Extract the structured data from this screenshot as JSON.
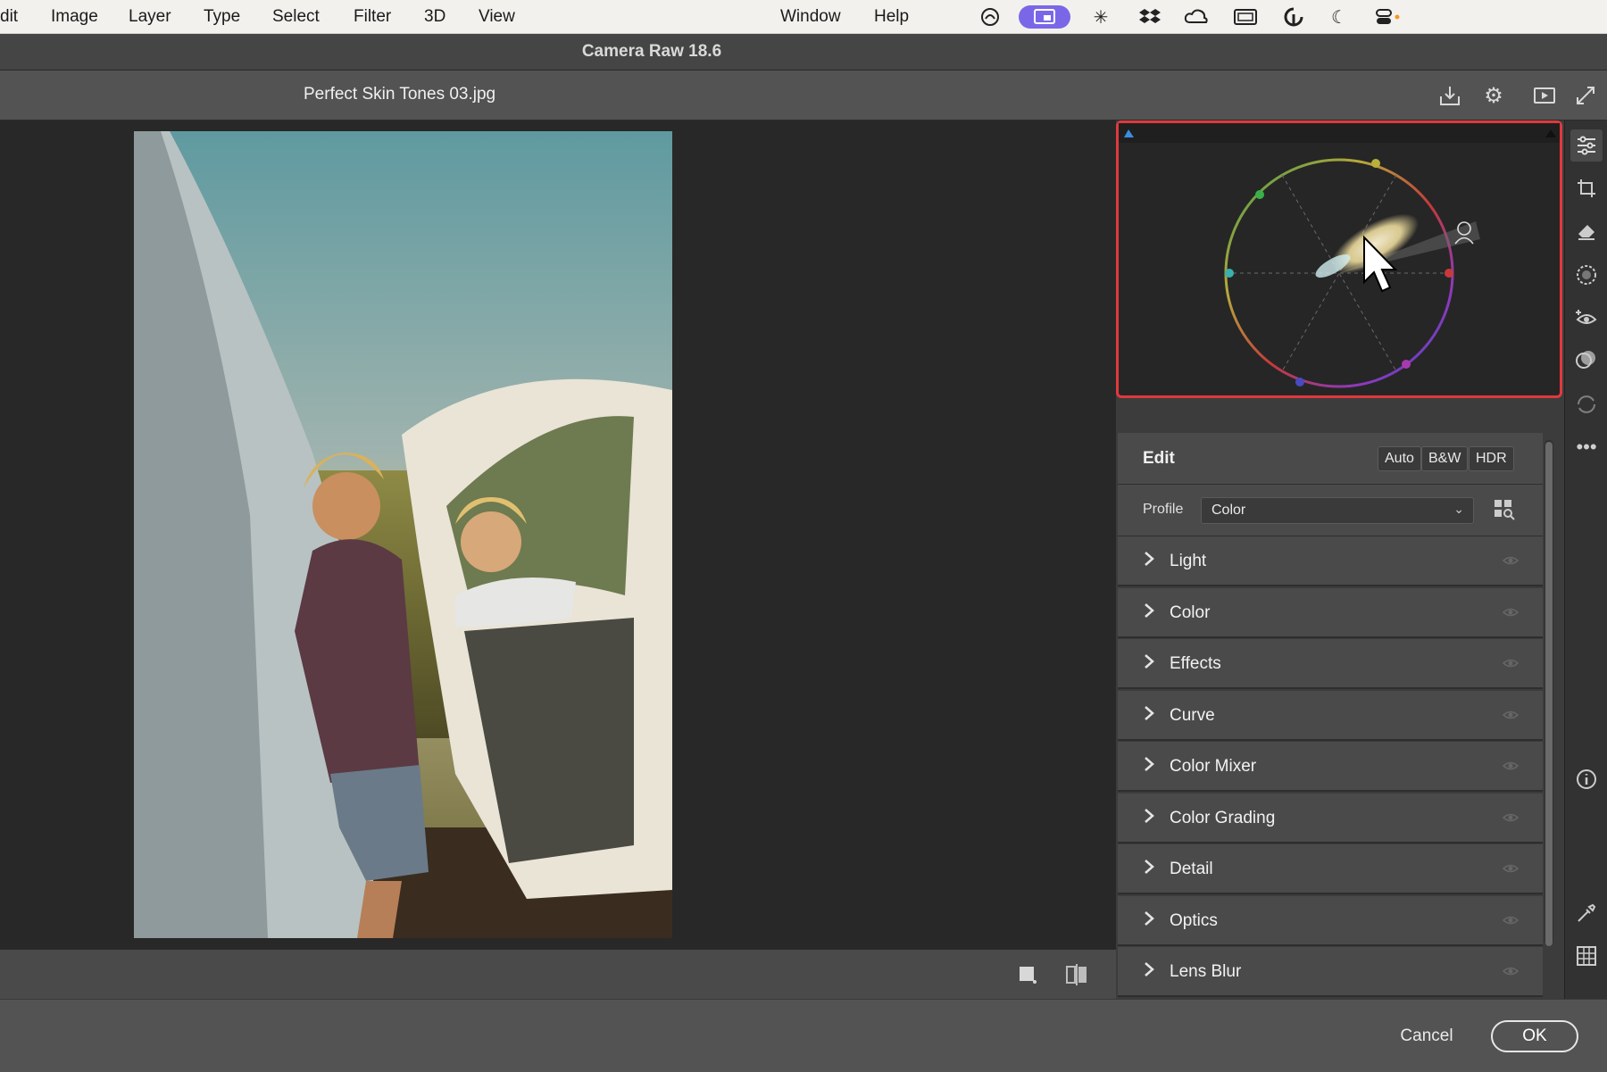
{
  "menubar": {
    "items": [
      "dit",
      "Image",
      "Layer",
      "Type",
      "Select",
      "Filter",
      "3D",
      "View",
      "Window",
      "Help"
    ],
    "tray_icons": [
      "creative-cloud-icon",
      "screen-share-icon",
      "sparkle-icon",
      "dropbox-icon",
      "cloud-sync-icon",
      "display-icon",
      "refresh-circle-icon",
      "moon-icon",
      "control-center-icon"
    ]
  },
  "titlebar": {
    "title": "Camera Raw 18.6"
  },
  "filebar": {
    "filename": "Perfect Skin Tones 03.jpg",
    "icons": [
      "save-icon",
      "settings-gear-icon",
      "slideshow-icon",
      "fullscreen-icon"
    ]
  },
  "canvas": {
    "bottom_icons": [
      "single-view-icon",
      "before-after-icon"
    ]
  },
  "histogram": {
    "type": "color-wheel-vectorscope",
    "accent_color": "#e0393e"
  },
  "tools": [
    "edit-sliders-icon",
    "crop-icon",
    "eraser-icon",
    "masking-icon",
    "red-eye-icon",
    "presets-icon",
    "snapshots-icon",
    "more-icon",
    "info-icon",
    "eyedropper-icon",
    "grid-icon"
  ],
  "edit": {
    "title": "Edit",
    "buttons": {
      "auto": "Auto",
      "bw": "B&W",
      "hdr": "HDR"
    },
    "profile_label": "Profile",
    "profile_value": "Color",
    "sections": [
      "Light",
      "Color",
      "Effects",
      "Curve",
      "Color Mixer",
      "Color Grading",
      "Detail",
      "Optics",
      "Lens Blur"
    ]
  },
  "footer": {
    "cancel": "Cancel",
    "ok": "OK"
  }
}
